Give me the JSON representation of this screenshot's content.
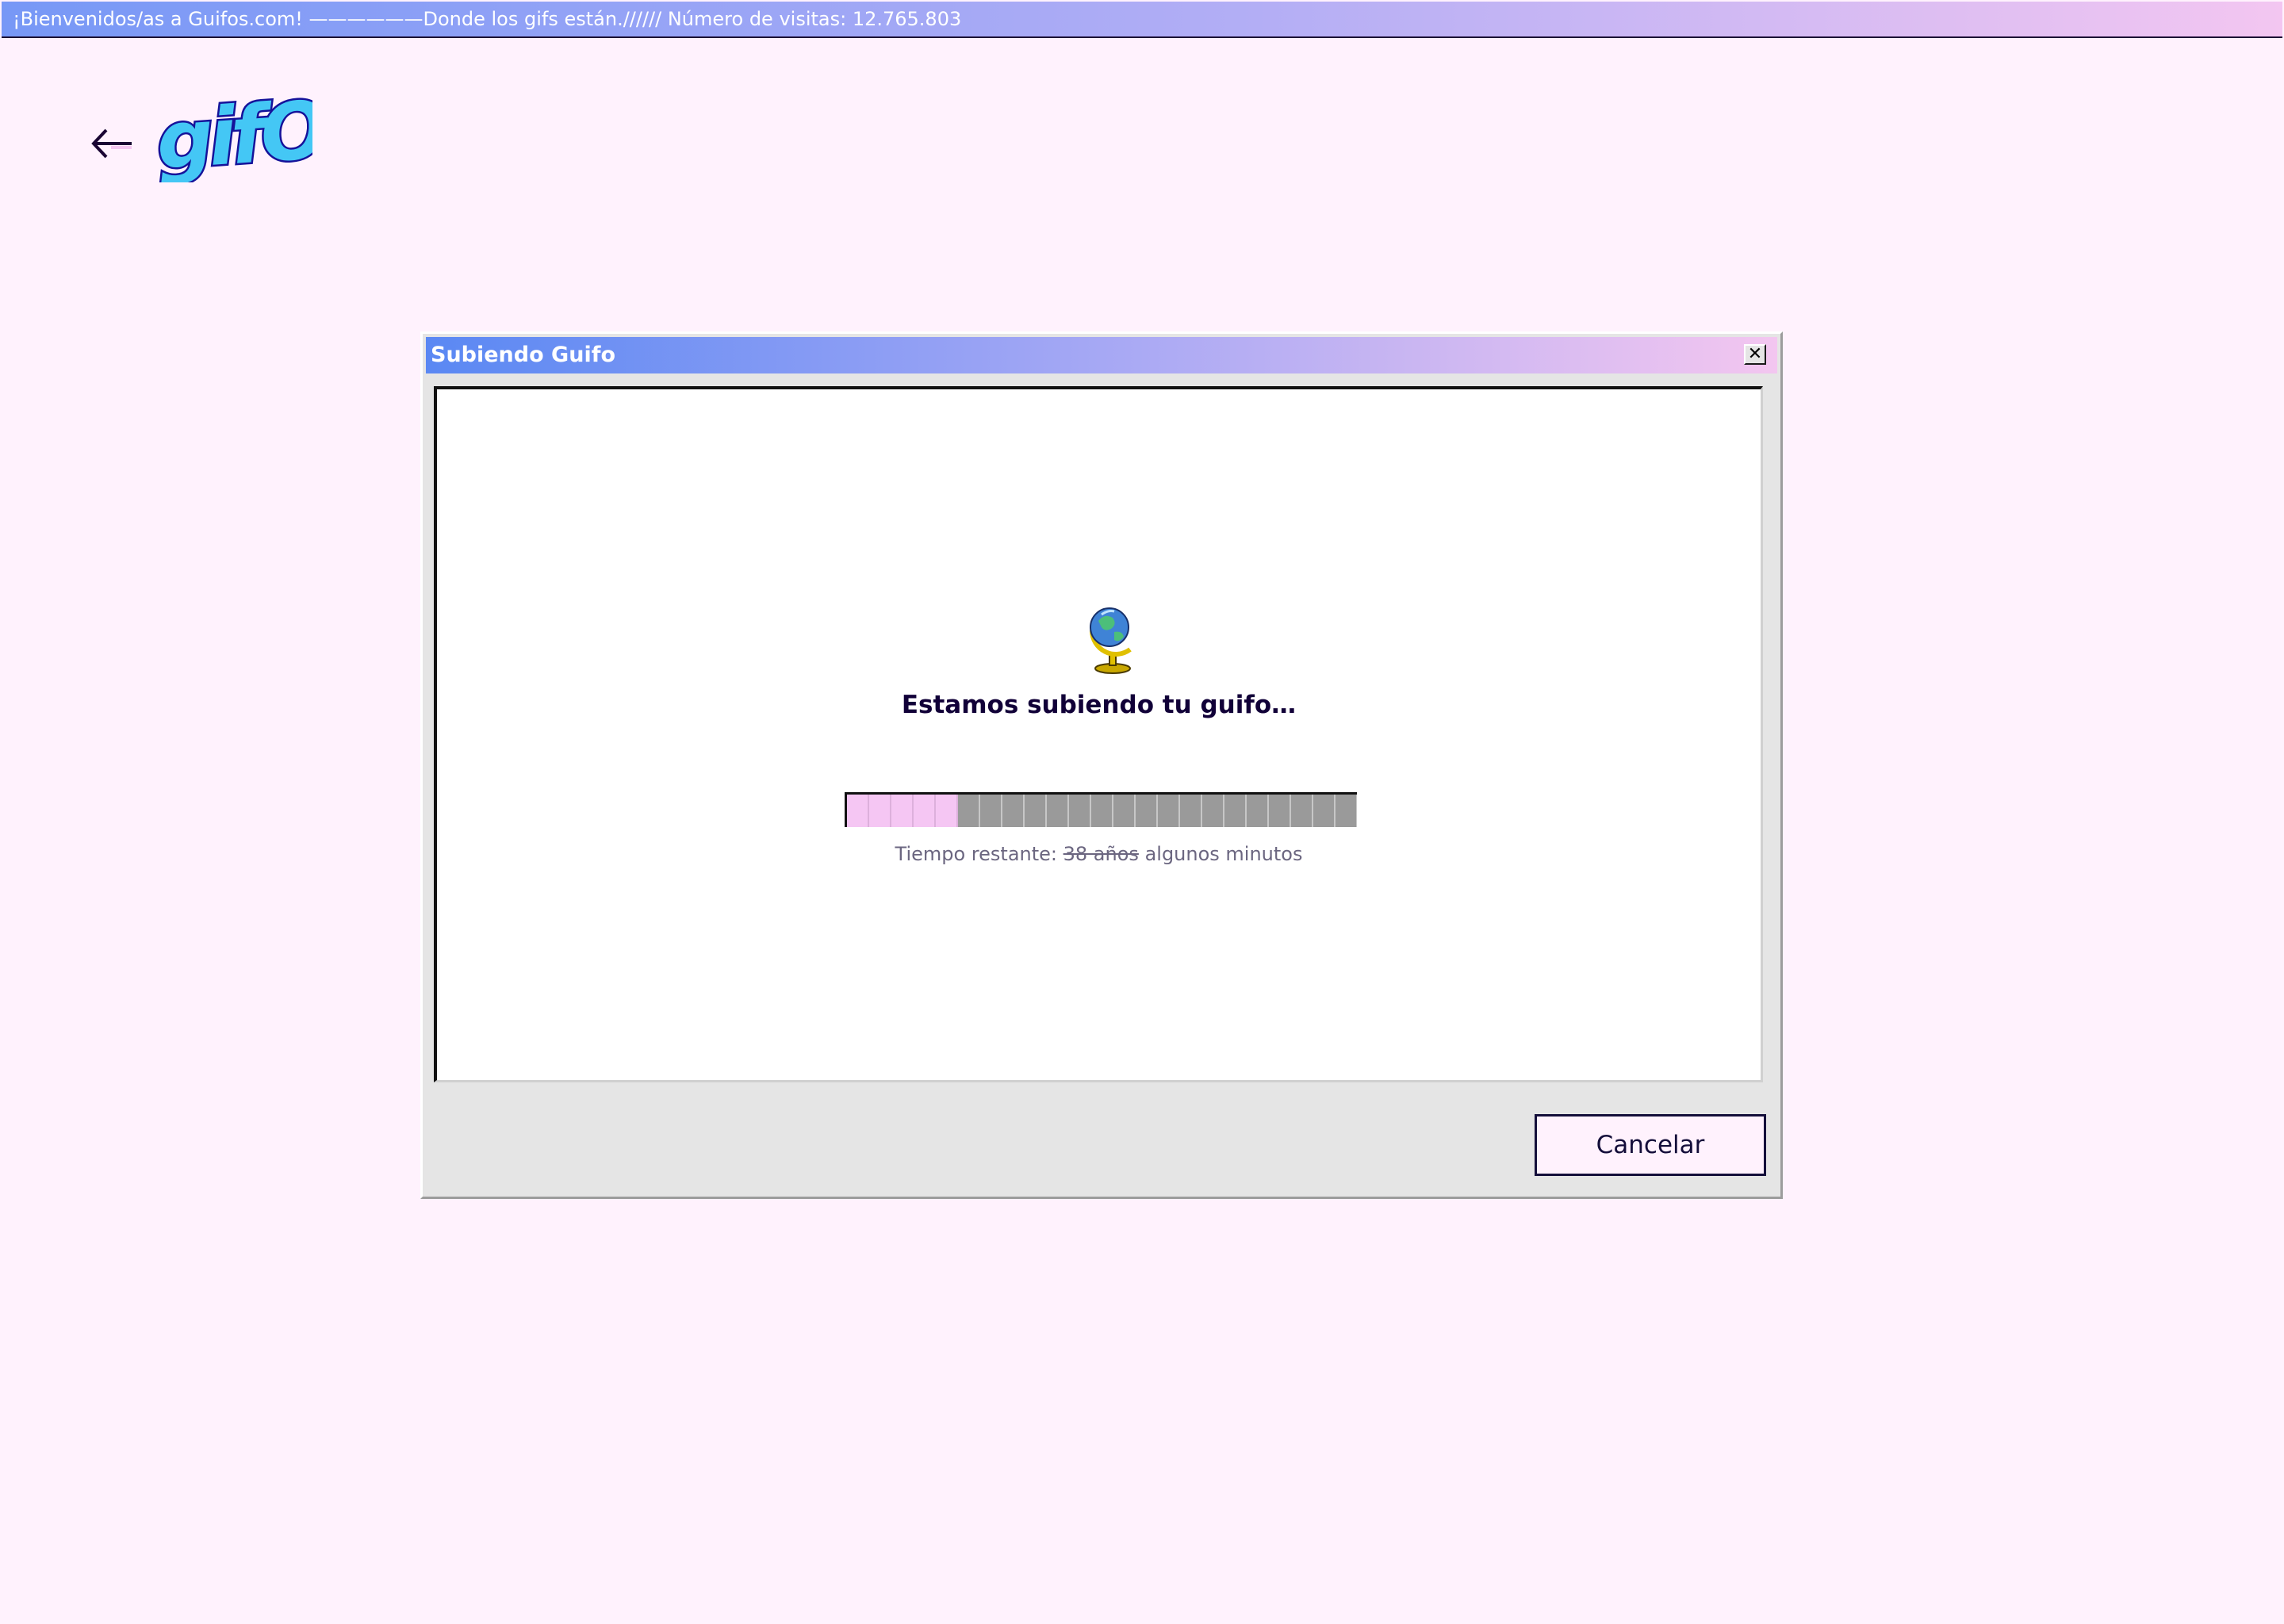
{
  "topbar": {
    "text": "¡Bienvenidos/as a Guifos.com! ——————Donde los gifs están.////// Número de visitas: 12.765.803"
  },
  "header": {
    "logo_text": "gifOS",
    "back_icon": "arrow-left-icon"
  },
  "dialog": {
    "title": "Subiendo Guifo",
    "close_label": "✕",
    "globe_icon": "globe-icon",
    "message": "Estamos subiendo tu guifo…",
    "progress": {
      "filled_segments": 5,
      "total_segments": 23
    },
    "remaining_label": "Tiempo restante:",
    "remaining_struck": "38 años",
    "remaining_value": "algunos minutos",
    "cancel_label": "Cancelar"
  },
  "colors": {
    "background": "#fff2fd",
    "accent_blue": "#5a88f3",
    "accent_pink": "#f3c6f0",
    "progress_fill": "#f5c6f3",
    "text_dark": "#110038"
  }
}
